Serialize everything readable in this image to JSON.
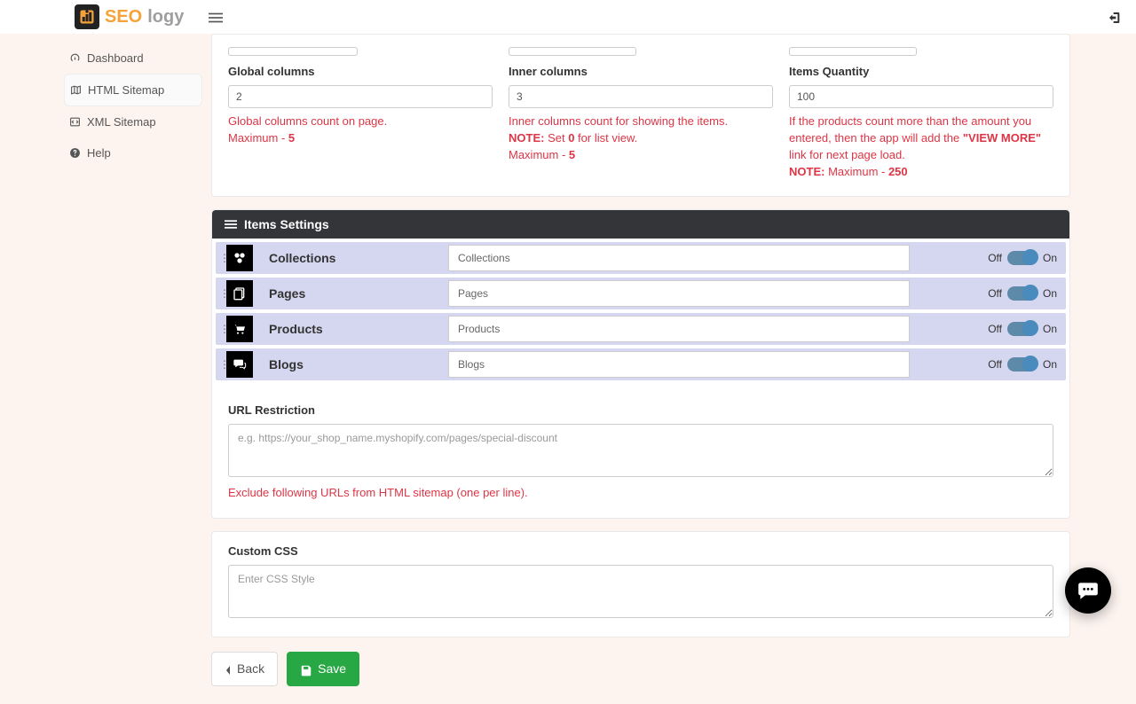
{
  "logo": {
    "seo": "SEO",
    "logy": "logy"
  },
  "sidebar": {
    "items": [
      {
        "label": "Dashboard"
      },
      {
        "label": "HTML Sitemap"
      },
      {
        "label": "XML Sitemap"
      },
      {
        "label": "Help"
      }
    ]
  },
  "top_fields": {
    "global_columns": {
      "label": "Global columns",
      "value": "2",
      "help1": "Global columns count on page.",
      "help2_pre": "Maximum - ",
      "help2_val": "5"
    },
    "inner_columns": {
      "label": "Inner columns",
      "value": "3",
      "help1": "Inner columns count for showing the items.",
      "note_label": "NOTE:",
      "note_text_a": " Set ",
      "note_val": "0",
      "note_text_b": " for list view.",
      "help3_pre": "Maximum - ",
      "help3_val": "5"
    },
    "items_qty": {
      "label": "Items Quantity",
      "value": "100",
      "help1": "If the products count more than the amount you entered, then the app will add the ",
      "viewmore": "\"VIEW MORE\"",
      "help1b": " link for next page load.",
      "note_label": "NOTE:",
      "note_text": " Maximum - ",
      "note_val": "250"
    }
  },
  "items_settings": {
    "title": "Items Settings",
    "off": "Off",
    "on": "On",
    "rows": [
      {
        "name": "Collections",
        "value": "Collections"
      },
      {
        "name": "Pages",
        "value": "Pages"
      },
      {
        "name": "Products",
        "value": "Products"
      },
      {
        "name": "Blogs",
        "value": "Blogs"
      }
    ]
  },
  "url_restriction": {
    "label": "URL Restriction",
    "placeholder": "e.g. https://your_shop_name.myshopify.com/pages/special-discount",
    "help": "Exclude following URLs from HTML sitemap (one per line)."
  },
  "custom_css": {
    "label": "Custom CSS",
    "placeholder": "Enter CSS Style"
  },
  "actions": {
    "back": "Back",
    "save": "Save"
  }
}
